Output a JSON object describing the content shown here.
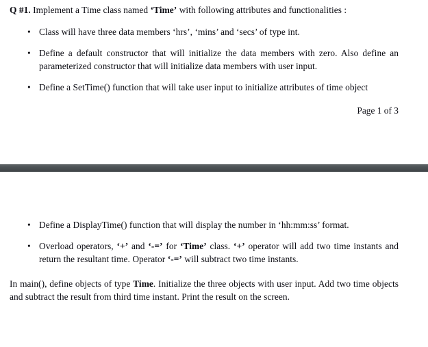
{
  "document": {
    "question_label": "Q #1.",
    "question_text": " Implement a Time class named ‘Time’ with following attributes and functionalities :",
    "section_one": {
      "bullets": [
        "Class will have three data members ‘hrs’, ‘mins’ and ‘secs’ of type int.",
        "Define a default constructor that will initialize the data members with zero. Also define an parameterized constructor that will initialize data members with user input.",
        "Define a SetTime() function that will take user input to initialize attributes of time object"
      ],
      "footer": "Page 1 of 3"
    },
    "divider": {
      "color": "#4a4f52"
    },
    "section_two": {
      "bullets": [
        "Define a DisplayTime() function that will display the number in ‘hh:mm:ss’ format.",
        "Overload operators, ‘+’ and ‘-=’ for ‘Time’ class. ‘+’ operator will add two time instants and return the resultant time. Operator ‘-=’ will subtract two time instants."
      ],
      "closing_paragraph": "In main(), define objects of type Time. Initialize the three objects with user input. Add two time objects and subtract the result from third time instant. Print the result on the screen."
    },
    "emphasis": {
      "time_class_quoted": "‘Time’",
      "time_class_plain": "Time",
      "plus_operator": "‘+’",
      "minus_equals_operator": "‘-=’"
    },
    "bullet_glyph": "•"
  }
}
